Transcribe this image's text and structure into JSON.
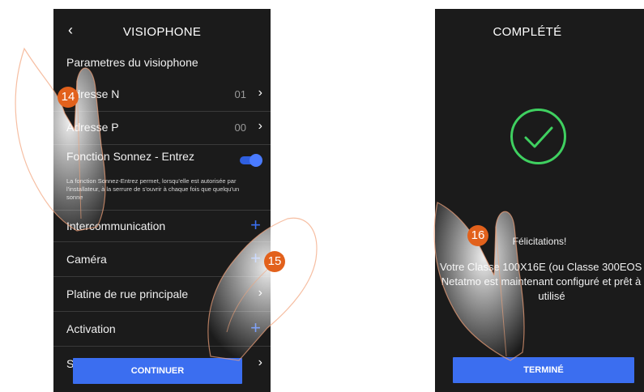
{
  "left_screen": {
    "title": "VISIOPHONE",
    "back_icon": "chevron-left-icon",
    "section_title": "Parametres du visiophone",
    "address_n": {
      "label": "Adresse N",
      "value": "01"
    },
    "address_p": {
      "label": "Adresse P",
      "value": "00"
    },
    "door_function": {
      "label": "Fonction Sonnez - Entrez",
      "enabled": true,
      "description": "La fonction Sonnez-Entrez permet, lorsqu'elle est autorisée par l'installateur, à la serrure de s'ouvrir à chaque fois que quelqu'un sonne"
    },
    "intercom_label": "Intercommunication",
    "camera_label": "Caméra",
    "main_panel_label": "Platine de rue principale",
    "activation_label": "Activation",
    "last_row_label": "S",
    "continue_button": "CONTINUER"
  },
  "right_screen": {
    "title": "COMPLÉTÉ",
    "success_icon": "check-circle-icon",
    "congrats": "Félicitations!",
    "message": "Votre Classe 100X16E (ou Classe 300EOS with Netatmo est maintenant configuré et prêt à être utilisé",
    "done_button": "TERMINÉ"
  },
  "steps": {
    "step14": "14",
    "step15": "15",
    "step16": "16"
  },
  "colors": {
    "accent": "#3b6ef0",
    "success": "#3fd060",
    "badge": "#e2611c",
    "panel": "#1b1b1b"
  }
}
